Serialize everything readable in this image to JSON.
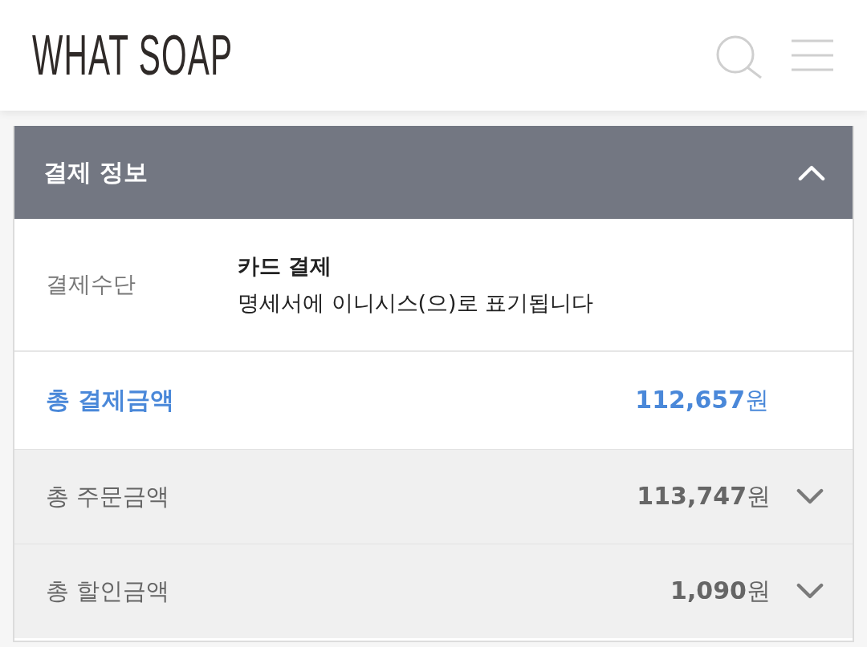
{
  "header": {
    "logo": "WHAT SOAP"
  },
  "payment_section": {
    "title": "결제 정보",
    "expanded": true,
    "method": {
      "label": "결제수단",
      "name": "카드 결제",
      "note": "명세서에 이니시스(으)로 표기됩니다"
    },
    "total": {
      "label": "총 결제금액",
      "amount": "**112,657**원"
    },
    "details": [
      {
        "label": "총 주문금액",
        "amount": "**113,747**원",
        "expanded": false
      },
      {
        "label": "총 할인금액",
        "amount": "**1,090**원",
        "expanded": false
      }
    ]
  }
}
